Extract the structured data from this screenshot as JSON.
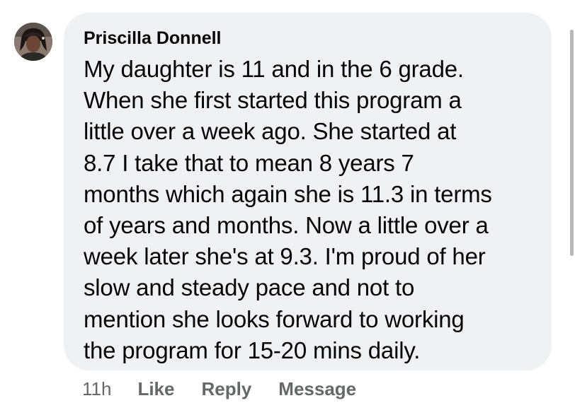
{
  "comment": {
    "author": "Priscilla Donnell",
    "lines": [
      "My daughter is 11 and in the 6 grade.",
      "When she first started this program a",
      "little over a week ago. She started at",
      "8.7 I take that to mean 8 years 7",
      "months which again she is 11.3 in terms",
      "of years and months. Now a little over a",
      "week later she's at 9.3. I'm proud of her",
      "slow and steady pace and not to",
      "mention she looks forward to working",
      "the program for 15-20 mins daily."
    ],
    "timestamp": "11h",
    "actions": {
      "like": "Like",
      "reply": "Reply",
      "message": "Message"
    }
  },
  "colors": {
    "bubble_bg": "#f0f1f5",
    "text": "#050505",
    "secondary_text": "#65676b"
  },
  "icons": {
    "avatar": "profile-photo"
  }
}
